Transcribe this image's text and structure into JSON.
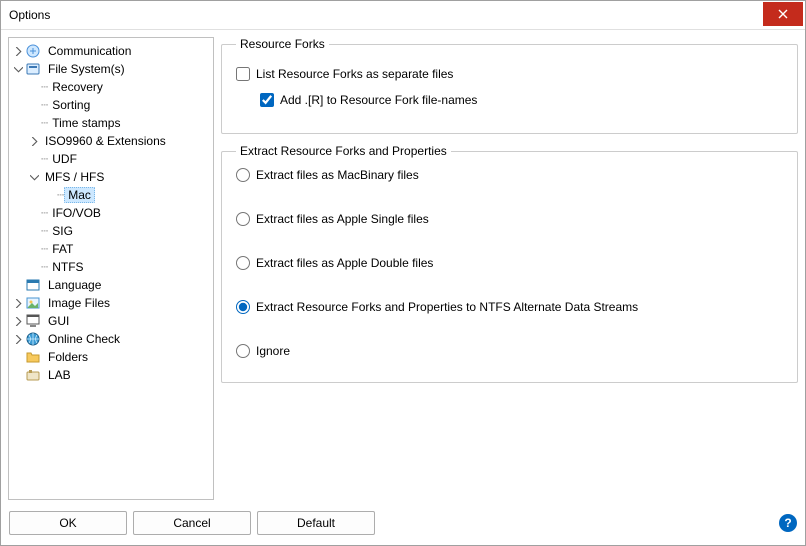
{
  "window": {
    "title": "Options"
  },
  "tree": {
    "communication": "Communication",
    "filesystems": "File System(s)",
    "recovery": "Recovery",
    "sorting": "Sorting",
    "timestamps": "Time stamps",
    "iso": "ISO9960 & Extensions",
    "udf": "UDF",
    "mfshfs": "MFS / HFS",
    "mac": "Mac",
    "ifovob": "IFO/VOB",
    "sig": "SIG",
    "fat": "FAT",
    "ntfs": "NTFS",
    "language": "Language",
    "imagefiles": "Image Files",
    "gui": "GUI",
    "onlinecheck": "Online Check",
    "folders": "Folders",
    "lab": "LAB"
  },
  "group1": {
    "legend": "Resource Forks",
    "chk_list": "List Resource Forks as separate files",
    "chk_addR": "Add .[R] to Resource Fork file-names"
  },
  "group2": {
    "legend": "Extract Resource Forks and Properties",
    "r_macbinary": "Extract files as MacBinary files",
    "r_applesingle": "Extract files as Apple Single files",
    "r_appledouble": "Extract files as Apple Double files",
    "r_ntfsads": "Extract Resource Forks and Properties to NTFS Alternate Data Streams",
    "r_ignore": "Ignore"
  },
  "form_state": {
    "chk_list": false,
    "chk_addR": true,
    "extract_mode": "ntfsads"
  },
  "footer": {
    "ok": "OK",
    "cancel": "Cancel",
    "default_": "Default"
  }
}
